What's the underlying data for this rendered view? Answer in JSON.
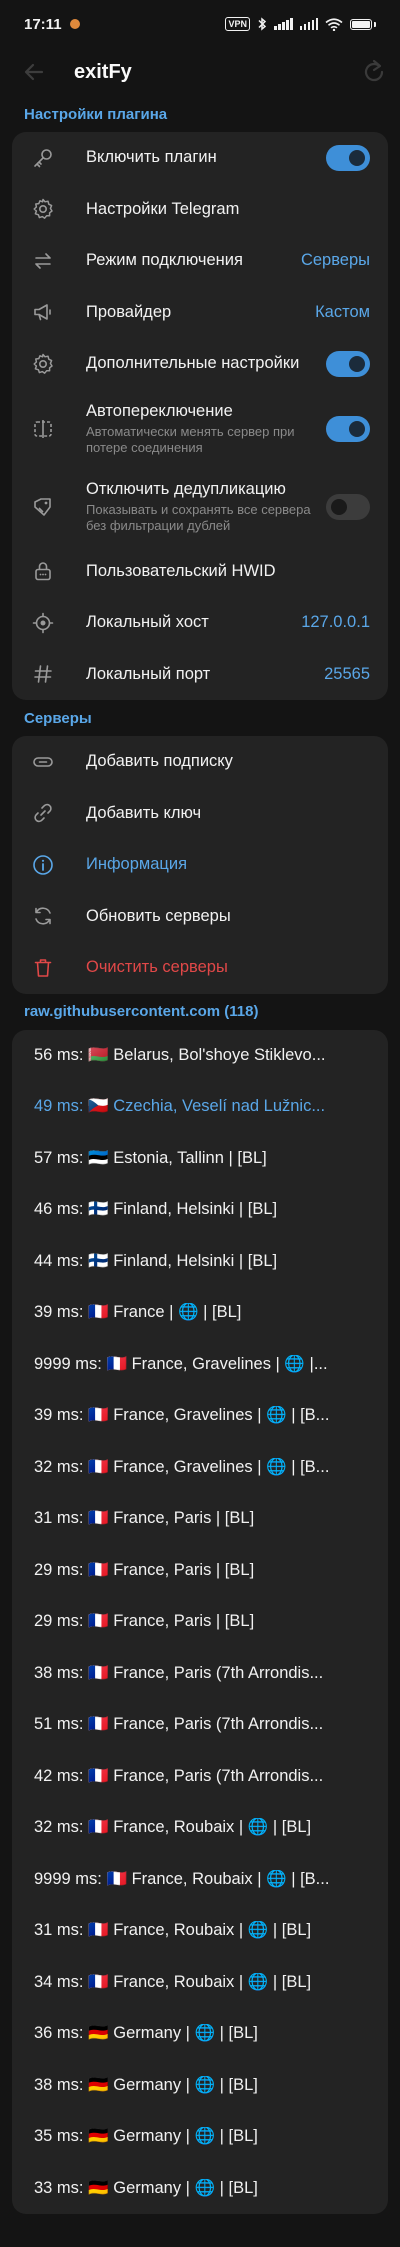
{
  "status_bar": {
    "time": "17:11",
    "vpn": "VPN"
  },
  "app_bar": {
    "title": "exitFy"
  },
  "plugin_section": {
    "header": "Настройки плагина",
    "items": [
      {
        "label": "Включить плагин",
        "icon": "key-icon",
        "toggle": "on"
      },
      {
        "label": "Настройки Telegram",
        "icon": "gear-icon"
      },
      {
        "label": "Режим подключения",
        "icon": "swap-arrows-icon",
        "value": "Серверы"
      },
      {
        "label": "Провайдер",
        "icon": "megaphone-icon",
        "value": "Кастом"
      },
      {
        "label": "Дополнительные настройки",
        "icon": "gear-icon",
        "toggle": "on"
      },
      {
        "label": "Автопереключение",
        "desc": "Автоматически менять сервер при потере соединения",
        "icon": "split-icon",
        "toggle": "on"
      },
      {
        "label": "Отключить дедупликацию",
        "desc": "Показывать и сохранять все сервера без фильтрации дублей",
        "icon": "tag-icon",
        "toggle": "off"
      },
      {
        "label": "Пользовательский HWID",
        "icon": "lock-icon"
      },
      {
        "label": "Локальный хост",
        "icon": "target-icon",
        "value": "127.0.0.1"
      },
      {
        "label": "Локальный порт",
        "icon": "hash-icon",
        "value": "25565"
      }
    ]
  },
  "servers_section": {
    "header": "Серверы",
    "items": [
      {
        "label": "Добавить подписку",
        "icon": "link-icon"
      },
      {
        "label": "Добавить ключ",
        "icon": "chain-icon"
      },
      {
        "label": "Информация",
        "icon": "info-icon"
      },
      {
        "label": "Обновить серверы",
        "icon": "refresh-icon"
      },
      {
        "label": "Очистить серверы",
        "icon": "trash-icon"
      }
    ]
  },
  "server_list": {
    "header": "raw.githubusercontent.com (118)",
    "items": [
      "56 ms: 🇧🇾 Belarus, Bol'shoye Stiklevo...",
      "49 ms: 🇨🇿 Czechia, Veselí nad Lužnic...",
      "57 ms: 🇪🇪 Estonia, Tallinn | [BL]",
      "46 ms: 🇫🇮 Finland, Helsinki | [BL]",
      "44 ms: 🇫🇮 Finland, Helsinki | [BL]",
      "39 ms: 🇫🇷 France | 🌐 | [BL]",
      "9999 ms: 🇫🇷 France, Gravelines | 🌐 |...",
      "39 ms: 🇫🇷 France, Gravelines | 🌐 | [B...",
      "32 ms: 🇫🇷 France, Gravelines | 🌐 | [B...",
      "31 ms: 🇫🇷 France, Paris | [BL]",
      "29 ms: 🇫🇷 France, Paris | [BL]",
      "29 ms: 🇫🇷 France, Paris | [BL]",
      "38 ms: 🇫🇷 France, Paris (7th Arrondis...",
      "51 ms: 🇫🇷 France, Paris (7th Arrondis...",
      "42 ms: 🇫🇷 France, Paris (7th Arrondis...",
      "32 ms: 🇫🇷 France, Roubaix | 🌐 | [BL]",
      "9999 ms: 🇫🇷 France, Roubaix | 🌐 | [B...",
      "31 ms: 🇫🇷 France, Roubaix | 🌐 | [BL]",
      "34 ms: 🇫🇷 France, Roubaix | 🌐 | [BL]",
      "36 ms: 🇩🇪 Germany | 🌐 | [BL]",
      "38 ms: 🇩🇪 Germany | 🌐 | [BL]",
      "35 ms: 🇩🇪 Germany | 🌐 | [BL]",
      "33 ms: 🇩🇪 Germany | 🌐 | [BL]"
    ],
    "active_index": 1
  },
  "colors": {
    "accent": "#5aa7e8",
    "danger": "#e04848",
    "card": "#232323",
    "background": "#141414"
  }
}
